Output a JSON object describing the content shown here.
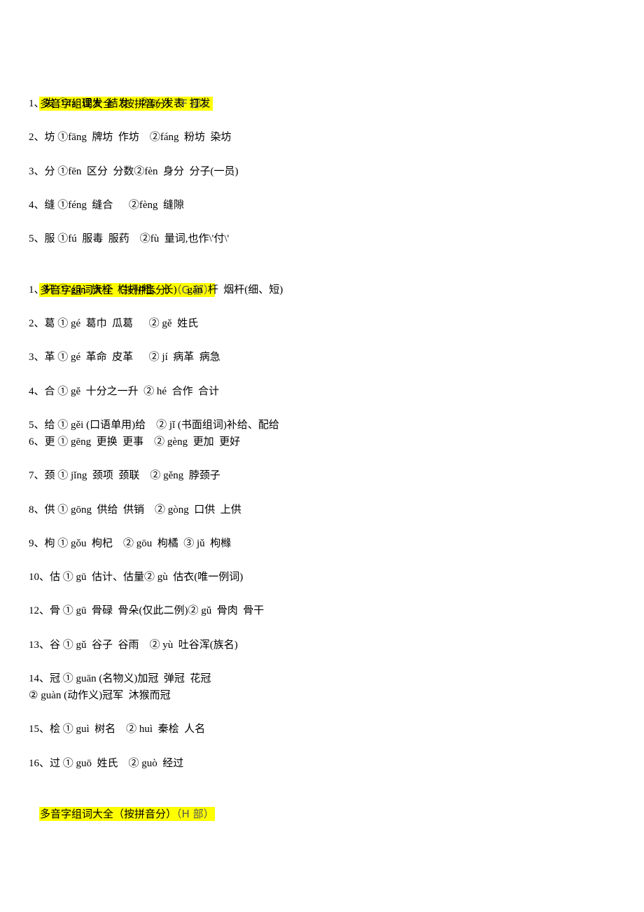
{
  "document": {
    "sections": [
      {
        "heading_main": "多音字组词大全（按拼音分）",
        "heading_suffix": "（F 部）",
        "highlight_color": "#ffff00"
      },
      {
        "heading_main": "多音字组词大全（按拼音分）",
        "heading_suffix": "（G 部）",
        "highlight_color": "#ffff00"
      },
      {
        "heading_main": "多音字组词大全（按拼音分）",
        "heading_suffix": "（H 部）",
        "highlight_color": "#ffff00"
      }
    ],
    "lines": [
      "1、发 ①fà  理发  结发    ②fā  发表  打发",
      "2、坊 ①fāng  牌坊  作坊    ②fáng  粉坊  染坊",
      "3、分 ①fēn  区分  分数②fèn  身分  分子(一员)",
      "4、缝 ①féng  缝合      ②fèng  缝隙",
      "5、服 ①fú  服毒  服药    ②fù  量词,也作\\'付\\'",
      "1、杆 ① gān  旗杆  栏杆(粗、长)    gǎn  杆  烟杆(细、短)",
      "2、葛 ① gé  葛巾  瓜葛      ② gě  姓氏",
      "3、革 ① gé  革命  皮革      ② jí  病革  病急",
      "4、合 ① gě  十分之一升  ② hé  合作  合计",
      "5、给 ① gěi (口语单用)给    ② jǐ (书面组词)补给、配给",
      "6、更 ① gēng  更换  更事    ② gèng  更加  更好",
      "7、颈 ① jǐng  颈项  颈联    ② gěng  脖颈子",
      "8、供 ① gōng  供给  供销    ② gòng  口供  上供",
      "9、枸 ① gǒu  枸杞    ② gōu  枸橘  ③ jǔ  枸橼",
      "10、估 ① gū  估计、估量② gù  估衣(唯一例词)",
      "12、骨 ① gū  骨碌  骨朵(仅此二例)② gǔ  骨肉  骨干",
      "13、谷 ① gǔ  谷子  谷雨    ② yù  吐谷浑(族名)",
      "14、冠 ① guān (名物义)加冠  弹冠  花冠",
      "② guàn (动作义)冠军  沐猴而冠",
      "15、桧 ① guì  树名    ② huì  秦桧  人名",
      "16、过 ① guō  姓氏    ② guò  经过"
    ]
  }
}
